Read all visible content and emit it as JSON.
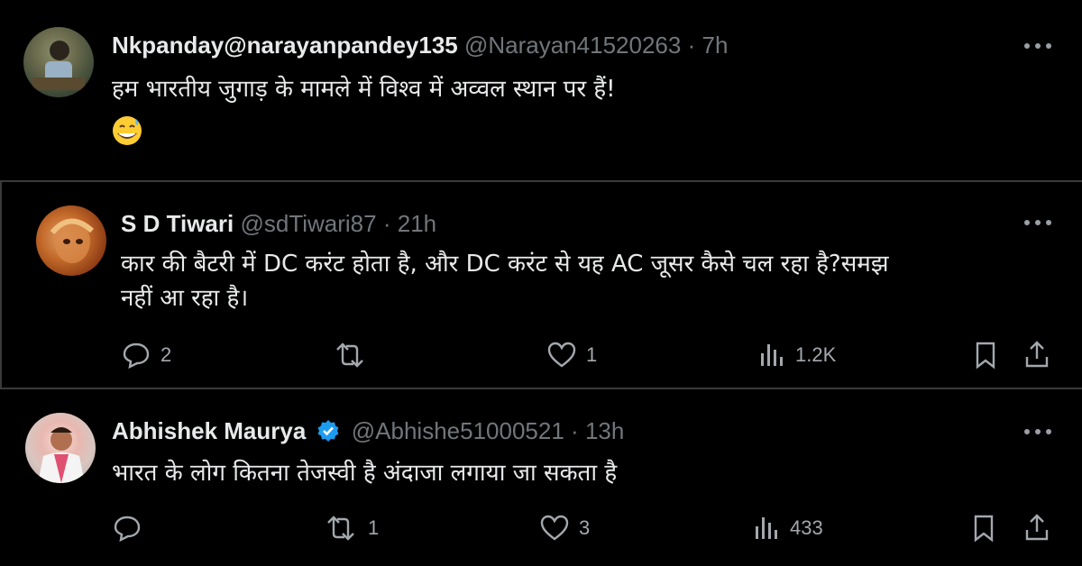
{
  "posts": [
    {
      "name": "Nkpanday@narayanpandey135",
      "handle": "@Narayan41520263",
      "separator": "·",
      "time": "7h",
      "text": "हम भारतीय जुगाड़ के मामले में विश्व में अव्वल स्थान पर हैं!",
      "emoji": "grinning-sweat-emoji"
    },
    {
      "name": "S D Tiwari",
      "handle": "@sdTiwari87",
      "separator": "·",
      "time": "21h",
      "text_line1": "कार की बैटरी में DC करंट होता है, और DC करंट से यह AC जूसर कैसे चल रहा है?समझ",
      "text_line2": "नहीं आ रहा है।",
      "replies": "2",
      "likes": "1",
      "views": "1.2K"
    },
    {
      "name": "Abhishek Maurya",
      "handle": "@Abhishe51000521",
      "separator": "·",
      "time": "13h",
      "verified": true,
      "text": "भारत के लोग कितना तेजस्वी है अंदाजा लगाया जा सकता है",
      "reposts": "1",
      "likes": "3",
      "views": "433"
    }
  ],
  "colors": {
    "background": "#000000",
    "text": "#e7e9ea",
    "muted": "#71767b",
    "verified": "#1d9bf0",
    "divider": "#3a3a3a"
  }
}
